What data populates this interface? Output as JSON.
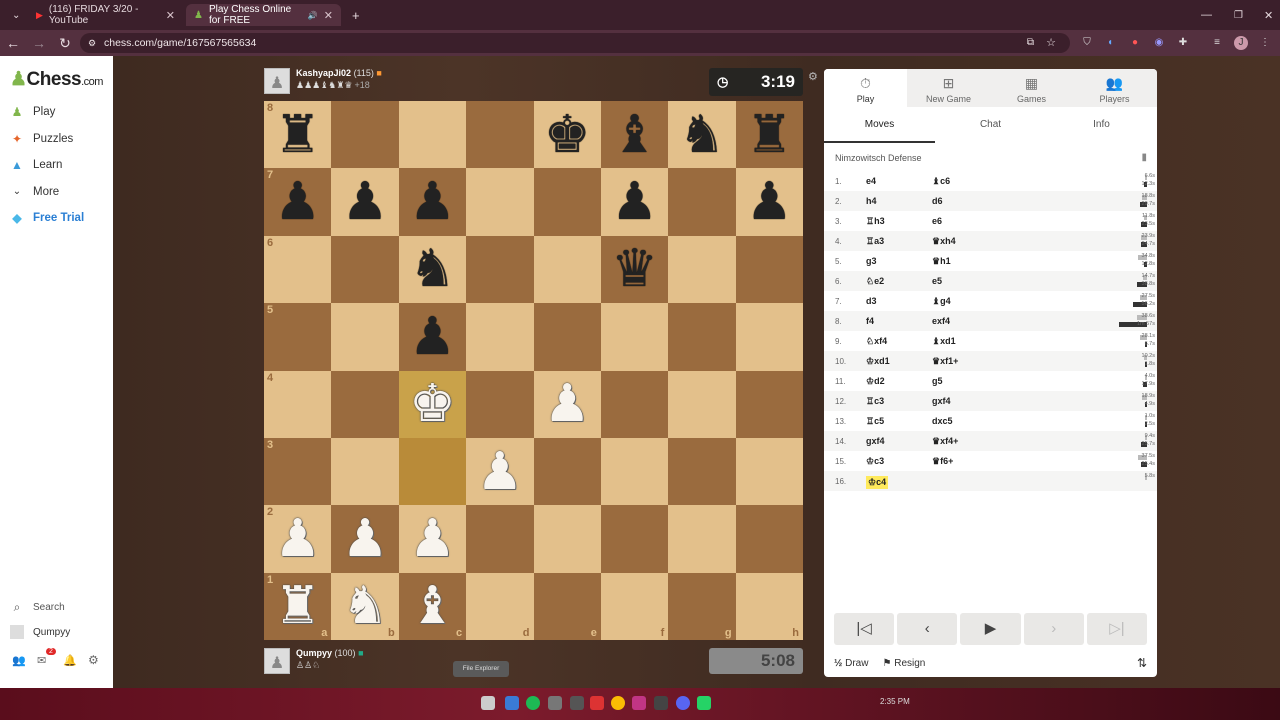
{
  "browser": {
    "tabs": [
      {
        "title": "(116) FRIDAY 3/20 - YouTube",
        "active": false
      },
      {
        "title": "Play Chess Online for FREE",
        "active": true
      }
    ],
    "url": "chess.com/game/167567565634"
  },
  "sidebar": {
    "logo": {
      "main": "Chess",
      "suffix": ".com"
    },
    "items": [
      {
        "label": "Play",
        "icon": "play-pawn-icon"
      },
      {
        "label": "Puzzles",
        "icon": "puzzle-icon"
      },
      {
        "label": "Learn",
        "icon": "learn-cap-icon"
      },
      {
        "label": "More",
        "icon": "chevron-down-icon"
      },
      {
        "label": "Free Trial",
        "icon": "diamond-icon"
      }
    ],
    "search_label": "Search",
    "user": "Qumpyy",
    "mail_badge": "2"
  },
  "players": {
    "top": {
      "name": "KashyapJi02",
      "rating": "(115)",
      "captured": "♟♟♟♝♞♜♛",
      "advantage": "+18",
      "clock": "3:19"
    },
    "bottom": {
      "name": "Qumpyy",
      "rating": "(100)",
      "captured": "♙♙♘",
      "clock": "5:08"
    }
  },
  "board": {
    "ranks": [
      "8",
      "7",
      "6",
      "5",
      "4",
      "3",
      "2",
      "1"
    ],
    "files": [
      "a",
      "b",
      "c",
      "d",
      "e",
      "f",
      "g",
      "h"
    ],
    "rows": [
      [
        "bR",
        "",
        "",
        "",
        "bK",
        "bB",
        "bN",
        "bR"
      ],
      [
        "bP",
        "bP",
        "bP",
        "",
        "",
        "bP",
        "",
        "bP"
      ],
      [
        "",
        "",
        "bN",
        "",
        "",
        "bQ",
        "",
        ""
      ],
      [
        "",
        "",
        "bP",
        "",
        "",
        "",
        "",
        ""
      ],
      [
        "",
        "",
        "wK",
        "",
        "wP",
        "",
        "",
        ""
      ],
      [
        "",
        "",
        "",
        "wP",
        "",
        "",
        "",
        ""
      ],
      [
        "wP",
        "wP",
        "wP",
        "",
        "",
        "",
        "",
        ""
      ],
      [
        "wR",
        "wN",
        "wB",
        "",
        "",
        "",
        "",
        ""
      ]
    ]
  },
  "panel": {
    "top_tabs": [
      {
        "label": "Play",
        "icon": "stopwatch-icon"
      },
      {
        "label": "New Game",
        "icon": "plus-square-icon"
      },
      {
        "label": "Games",
        "icon": "board-icon"
      },
      {
        "label": "Players",
        "icon": "players-icon"
      }
    ],
    "sub_tabs": [
      "Moves",
      "Chat",
      "Info"
    ],
    "opening": "Nimzowitsch Defense",
    "moves": [
      {
        "n": "1.",
        "w": "e4",
        "b": "♝c6",
        "tw": "6.6s",
        "tb": "12.3s"
      },
      {
        "n": "2.",
        "w": "h4",
        "b": "d6",
        "tw": "18.8s",
        "tb": "29.7s"
      },
      {
        "n": "3.",
        "w": "♖h3",
        "b": "e6",
        "tw": "11.8s",
        "tb": "23.5s"
      },
      {
        "n": "4.",
        "w": "♖a3",
        "b": "♛xh4",
        "tw": "23.9s",
        "tb": "24.7s"
      },
      {
        "n": "5.",
        "w": "g3",
        "b": "♛h1",
        "tw": "34.8s",
        "tb": "12.8s"
      },
      {
        "n": "6.",
        "w": "♘e2",
        "b": "e5",
        "tw": "14.7s",
        "tb": "38.8s"
      },
      {
        "n": "7.",
        "w": "d3",
        "b": "♝g4",
        "tw": "27.5s",
        "tb": "56.2s"
      },
      {
        "n": "8.",
        "w": "f4",
        "b": "exf4",
        "tw": "38.6s",
        "tb": "1m 57s"
      },
      {
        "n": "9.",
        "w": "♘xf4",
        "b": "♝xd1",
        "tw": "28.1s",
        "tb": "6.7s"
      },
      {
        "n": "10.",
        "w": "♔xd1",
        "b": "♛xf1+",
        "tw": "10.2s",
        "tb": "1.8s"
      },
      {
        "n": "11.",
        "w": "♔d2",
        "b": "g5",
        "tw": "4.0s",
        "tb": "17.9s"
      },
      {
        "n": "12.",
        "w": "♖c3",
        "b": "gxf4",
        "tw": "18.9s",
        "tb": "4.9s"
      },
      {
        "n": "13.",
        "w": "♖c5",
        "b": "dxc5",
        "tw": "1.0s",
        "tb": "2.5s"
      },
      {
        "n": "14.",
        "w": "gxf4",
        "b": "♛xf4+",
        "tw": "9.4s",
        "tb": "25.7s"
      },
      {
        "n": "15.",
        "w": "♔c3",
        "b": "♛f6+",
        "tw": "37.5s",
        "tb": "25.4s"
      },
      {
        "n": "16.",
        "w": "♔c4",
        "b": "",
        "tw": "5.8s",
        "tb": ""
      }
    ],
    "draw_label": "Draw",
    "resign_label": "Resign"
  },
  "taskbar": {
    "tooltip": "File Explorer",
    "time": "2:35 PM"
  }
}
